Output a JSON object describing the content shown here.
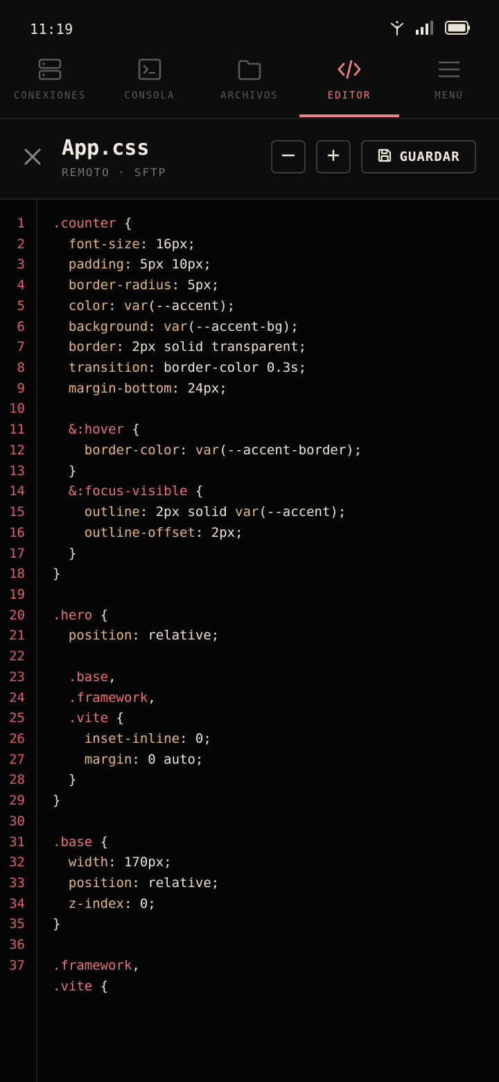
{
  "status": {
    "time": "11:19"
  },
  "tabs": [
    {
      "label": "CONEXIONES",
      "icon": "server-icon",
      "active": false
    },
    {
      "label": "CONSOLA",
      "icon": "terminal-icon",
      "active": false
    },
    {
      "label": "ARCHIVOS",
      "icon": "folder-icon",
      "active": false
    },
    {
      "label": "EDITOR",
      "icon": "code-icon",
      "active": true
    },
    {
      "label": "MENÚ",
      "icon": "menu-icon",
      "active": false
    }
  ],
  "file": {
    "name": "App.css",
    "subtitle": "REMOTO · SFTP",
    "save_label": "GUARDAR"
  },
  "colors": {
    "accent": "#f08288",
    "background": "#050505",
    "panel": "#0d0d0d"
  },
  "code_lines": [
    [
      {
        "t": ".counter",
        "c": "sel"
      },
      {
        "t": " {",
        "c": "punc"
      }
    ],
    [
      {
        "t": "  font-size",
        "c": "prop"
      },
      {
        "t": ": 16px;",
        "c": "val"
      }
    ],
    [
      {
        "t": "  padding",
        "c": "prop"
      },
      {
        "t": ": 5px 10px;",
        "c": "val"
      }
    ],
    [
      {
        "t": "  border-radius",
        "c": "prop"
      },
      {
        "t": ": 5px;",
        "c": "val"
      }
    ],
    [
      {
        "t": "  color",
        "c": "prop"
      },
      {
        "t": ": ",
        "c": "val"
      },
      {
        "t": "var",
        "c": "fn"
      },
      {
        "t": "(--accent);",
        "c": "val"
      }
    ],
    [
      {
        "t": "  background",
        "c": "prop"
      },
      {
        "t": ": ",
        "c": "val"
      },
      {
        "t": "var",
        "c": "fn"
      },
      {
        "t": "(--accent-bg);",
        "c": "val"
      }
    ],
    [
      {
        "t": "  border",
        "c": "prop"
      },
      {
        "t": ": 2px solid transparent;",
        "c": "val"
      }
    ],
    [
      {
        "t": "  transition",
        "c": "prop"
      },
      {
        "t": ": border-color 0.3s;",
        "c": "val"
      }
    ],
    [
      {
        "t": "  margin-bottom",
        "c": "prop"
      },
      {
        "t": ": 24px;",
        "c": "val"
      }
    ],
    [],
    [
      {
        "t": "  &:hover",
        "c": "sel"
      },
      {
        "t": " {",
        "c": "punc"
      }
    ],
    [
      {
        "t": "    border-color",
        "c": "prop"
      },
      {
        "t": ": ",
        "c": "val"
      },
      {
        "t": "var",
        "c": "fn"
      },
      {
        "t": "(--accent-border);",
        "c": "val"
      }
    ],
    [
      {
        "t": "  }",
        "c": "punc"
      }
    ],
    [
      {
        "t": "  &:focus-visible",
        "c": "sel"
      },
      {
        "t": " {",
        "c": "punc"
      }
    ],
    [
      {
        "t": "    outline",
        "c": "prop"
      },
      {
        "t": ": 2px solid ",
        "c": "val"
      },
      {
        "t": "var",
        "c": "fn"
      },
      {
        "t": "(--accent);",
        "c": "val"
      }
    ],
    [
      {
        "t": "    outline-offset",
        "c": "prop"
      },
      {
        "t": ": 2px;",
        "c": "val"
      }
    ],
    [
      {
        "t": "  }",
        "c": "punc"
      }
    ],
    [
      {
        "t": "}",
        "c": "punc"
      }
    ],
    [],
    [
      {
        "t": ".hero",
        "c": "sel"
      },
      {
        "t": " {",
        "c": "punc"
      }
    ],
    [
      {
        "t": "  position",
        "c": "prop"
      },
      {
        "t": ": relative;",
        "c": "val"
      }
    ],
    [],
    [
      {
        "t": "  .base",
        "c": "sel"
      },
      {
        "t": ",",
        "c": "punc"
      }
    ],
    [
      {
        "t": "  .framework",
        "c": "sel"
      },
      {
        "t": ",",
        "c": "punc"
      }
    ],
    [
      {
        "t": "  .vite",
        "c": "sel"
      },
      {
        "t": " {",
        "c": "punc"
      }
    ],
    [
      {
        "t": "    inset-inline",
        "c": "prop"
      },
      {
        "t": ": 0;",
        "c": "val"
      }
    ],
    [
      {
        "t": "    margin",
        "c": "prop"
      },
      {
        "t": ": 0 auto;",
        "c": "val"
      }
    ],
    [
      {
        "t": "  }",
        "c": "punc"
      }
    ],
    [
      {
        "t": "}",
        "c": "punc"
      }
    ],
    [],
    [
      {
        "t": ".base",
        "c": "sel"
      },
      {
        "t": " {",
        "c": "punc"
      }
    ],
    [
      {
        "t": "  width",
        "c": "prop"
      },
      {
        "t": ": 170px;",
        "c": "val"
      }
    ],
    [
      {
        "t": "  position",
        "c": "prop"
      },
      {
        "t": ": relative;",
        "c": "val"
      }
    ],
    [
      {
        "t": "  z-index",
        "c": "prop"
      },
      {
        "t": ": 0;",
        "c": "val"
      }
    ],
    [
      {
        "t": "}",
        "c": "punc"
      }
    ],
    [],
    [
      {
        "t": ".framework",
        "c": "sel"
      },
      {
        "t": ",",
        "c": "punc"
      }
    ],
    [
      {
        "t": ".vite",
        "c": "sel"
      },
      {
        "t": " {",
        "c": "punc"
      }
    ]
  ],
  "line_numbers": [
    "1",
    "2",
    "3",
    "4",
    "5",
    "6",
    "7",
    "8",
    "9",
    "10",
    "11",
    "12",
    "13",
    "14",
    "15",
    "16",
    "17",
    "18",
    "19",
    "20",
    "21",
    "22",
    "23",
    "24",
    "25",
    "26",
    "27",
    "28",
    "29",
    "30",
    "31",
    "32",
    "33",
    "34",
    "35",
    "36",
    "37"
  ]
}
